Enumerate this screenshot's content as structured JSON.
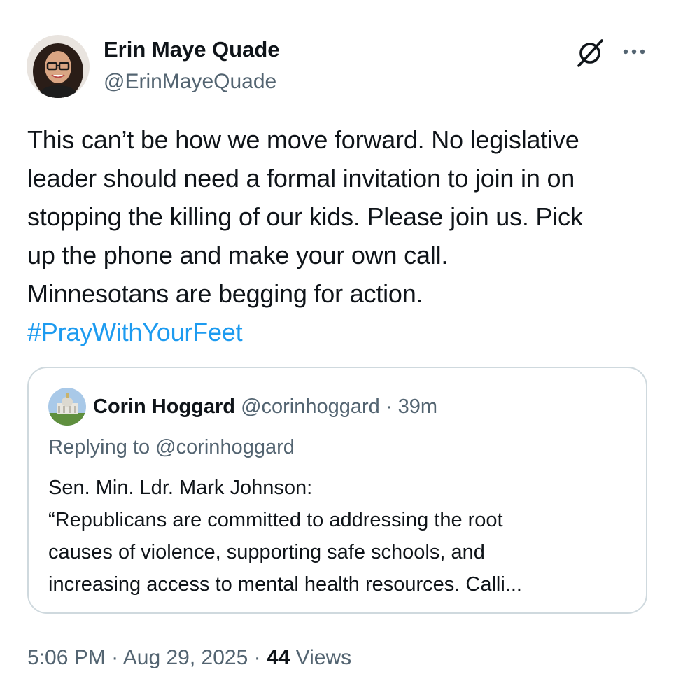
{
  "author": {
    "name": "Erin Maye Quade",
    "handle": "@ErinMayeQuade"
  },
  "header_icons": [
    "grok-icon",
    "more-icon"
  ],
  "tweet": {
    "lines": [
      "This can’t be how we move forward. No legislative",
      "leader should need a formal invitation to join in on",
      "stopping the killing of our kids. Please join us. Pick",
      "up the phone and make your own call.",
      "Minnesotans are begging for action."
    ],
    "hashtag": "#PrayWithYourFeet"
  },
  "quote": {
    "name": "Corin Hoggard",
    "handle": "@corinhoggard",
    "separator": "·",
    "time": "39m",
    "replying_to": "Replying to @corinhoggard",
    "lines": [
      "Sen. Min. Ldr. Mark Johnson:",
      "“Republicans are committed to addressing the root",
      "causes of violence, supporting safe schools, and",
      "increasing access to mental health resources.  Calli..."
    ]
  },
  "meta": {
    "time": "5:06 PM",
    "date": "Aug 29, 2025",
    "separator": "·",
    "views_count": "44",
    "views_label": "Views"
  },
  "colors": {
    "text": "#0f1419",
    "secondary": "#536471",
    "link": "#1d9bf0",
    "border": "#cfd9de"
  }
}
